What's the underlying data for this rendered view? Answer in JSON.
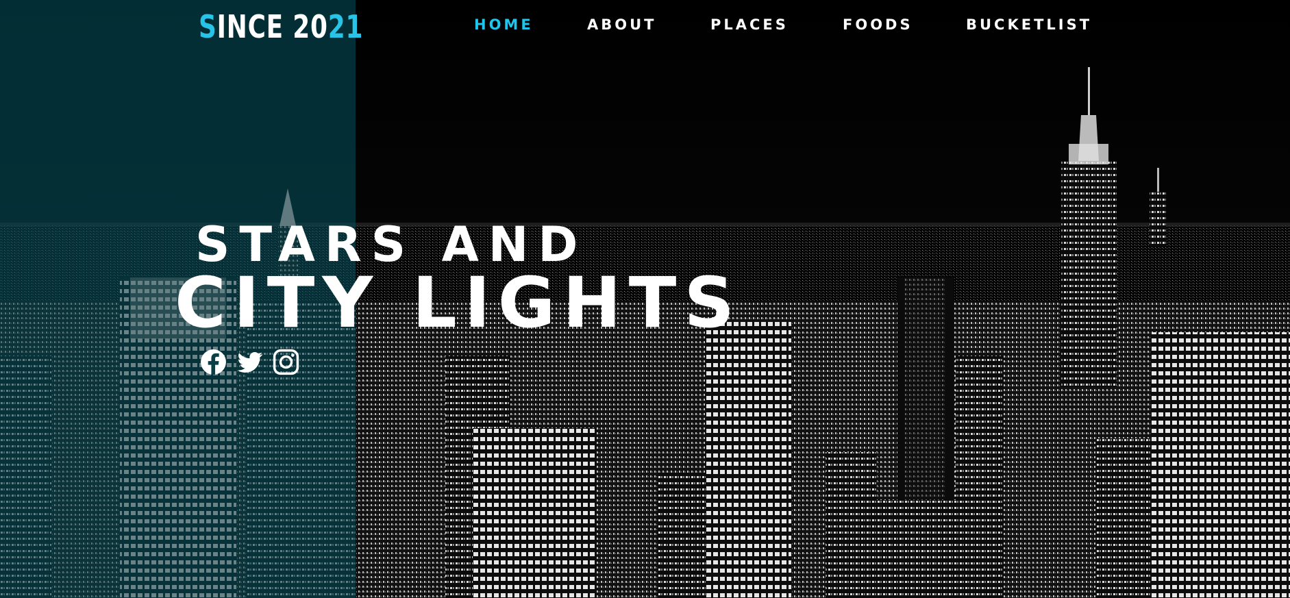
{
  "header": {
    "logo": {
      "part1": "S",
      "part2": "INCE 20",
      "part3": "21"
    },
    "nav": [
      {
        "label": "HOME",
        "active": true
      },
      {
        "label": "ABOUT",
        "active": false
      },
      {
        "label": "PLACES",
        "active": false
      },
      {
        "label": "FOODS",
        "active": false
      },
      {
        "label": "BUCKETLIST",
        "active": false
      }
    ]
  },
  "hero": {
    "line1": "STARS AND",
    "line2": "CITY LIGHTS",
    "background": "night city skyline photo"
  },
  "social": [
    {
      "icon": "facebook-icon"
    },
    {
      "icon": "twitter-icon"
    },
    {
      "icon": "instagram-icon"
    }
  ],
  "colors": {
    "accent": "#1ec6ee",
    "text": "#ffffff",
    "background": "#000000",
    "tint": "#0a3f46"
  }
}
